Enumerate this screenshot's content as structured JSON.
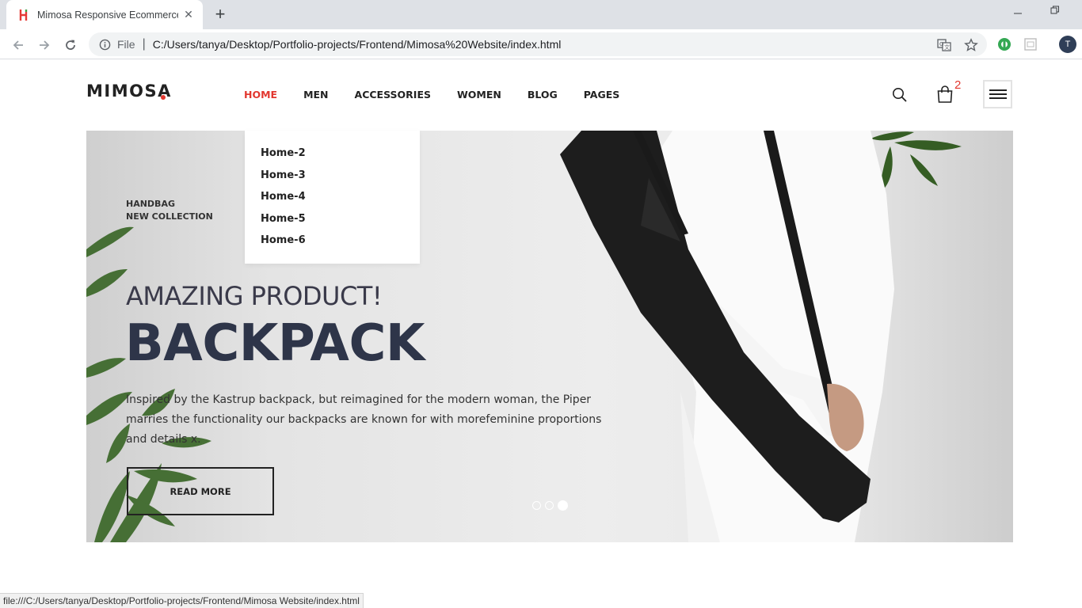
{
  "browser": {
    "tab_title": "Mimosa Responsive Ecommerce",
    "new_tab": "+",
    "close_tab": "✕",
    "url_scheme": "File",
    "url_separator": "|",
    "url": "C:/Users/tanya/Desktop/Portfolio-projects/Frontend/Mimosa%20Website/index.html",
    "profile_initial": "T",
    "status_url": "file:///C:/Users/tanya/Desktop/Portfolio-projects/Frontend/Mimosa Website/index.html"
  },
  "site": {
    "logo": "MIMOSA",
    "nav": {
      "home": "HOME",
      "men": "MEN",
      "accessories": "ACCESSORIES",
      "women": "WOMEN",
      "blog": "BLOG",
      "pages": "PAGES"
    },
    "cart_count": "2",
    "dropdown": [
      "Home-2",
      "Home-3",
      "Home-4",
      "Home-5",
      "Home-6"
    ],
    "hero": {
      "eyebrow_line1": "HANDBAG",
      "eyebrow_line2": "NEW COLLECTION",
      "subtitle": "AMAZING PRODUCT!",
      "title": "BACKPACK",
      "description": "Inspired by the Kastrup backpack, but reimagined for the modern woman, the Piper marries the functionality our backpacks are known for with morefeminine proportions and details x.",
      "button": "READ MORE",
      "active_slide": 3,
      "slide_count": 3
    }
  },
  "colors": {
    "accent": "#e2372f",
    "title": "#2e3549",
    "chrome_bg": "#dee1e6"
  },
  "icons": [
    "info-icon",
    "back-icon",
    "forward-icon",
    "reload-icon",
    "translate-icon",
    "star-icon",
    "search-icon",
    "cart-icon",
    "menu-icon"
  ]
}
